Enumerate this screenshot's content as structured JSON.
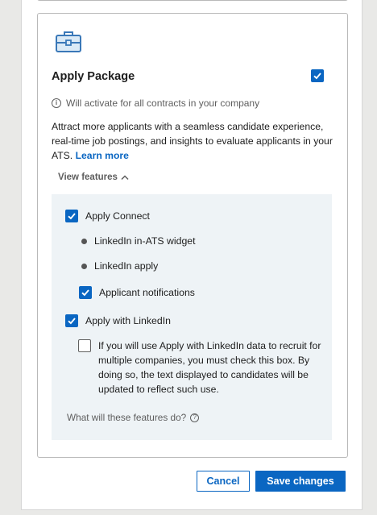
{
  "package": {
    "title": "Apply Package",
    "selected": true,
    "info": "Will activate for all contracts in your company",
    "description": "Attract more applicants with a seamless candidate experience, real-time job postings, and insights to evaluate applicants in your ATS.",
    "learn_more": "Learn more",
    "view_features": "View features"
  },
  "features": {
    "apply_connect": {
      "label": "Apply Connect",
      "checked": true
    },
    "bullets": [
      "LinkedIn in-ATS widget",
      "LinkedIn apply"
    ],
    "applicant_notifications": {
      "label": "Applicant notifications",
      "checked": true
    },
    "apply_with_linkedin": {
      "label": "Apply with LinkedIn",
      "checked": true
    },
    "multi_company_note": "If you will use Apply with LinkedIn data to recruit for multiple companies, you must check this box. By doing so, the text displayed to candidates will be updated to reflect such use.",
    "multi_company_checked": false,
    "help": "What will these features do?"
  },
  "footer": {
    "cancel": "Cancel",
    "save": "Save changes"
  },
  "colors": {
    "accent": "#0a66c2",
    "panel_bg": "#eef3f6",
    "icon_blue": "#3a78b8"
  }
}
